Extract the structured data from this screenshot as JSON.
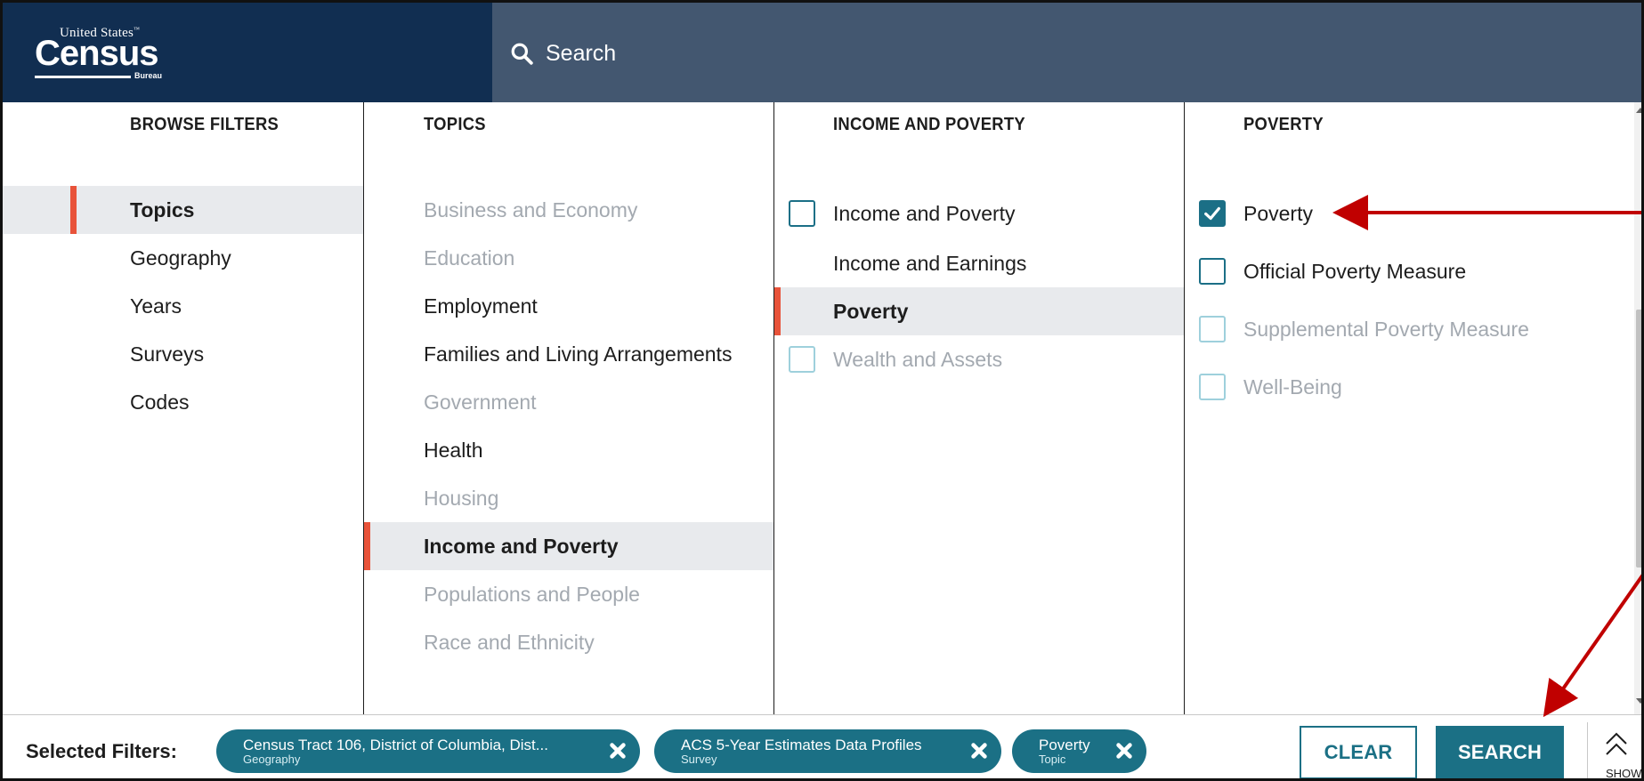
{
  "header": {
    "logo": {
      "top": "United States",
      "main": "Census",
      "bottom": "Bureau"
    },
    "search_placeholder": "Search"
  },
  "columns": {
    "browse": {
      "title": "BROWSE FILTERS",
      "items": [
        "Topics",
        "Geography",
        "Years",
        "Surveys",
        "Codes"
      ],
      "active": "Topics"
    },
    "topics": {
      "title": "TOPICS",
      "items": [
        {
          "label": "Business and Economy",
          "state": "dim"
        },
        {
          "label": "Education",
          "state": "dim"
        },
        {
          "label": "Employment",
          "state": "normal"
        },
        {
          "label": "Families and Living Arrangements",
          "state": "normal"
        },
        {
          "label": "Government",
          "state": "dim"
        },
        {
          "label": "Health",
          "state": "normal"
        },
        {
          "label": "Housing",
          "state": "dim"
        },
        {
          "label": "Income and Poverty",
          "state": "active"
        },
        {
          "label": "Populations and People",
          "state": "dim"
        },
        {
          "label": "Race and Ethnicity",
          "state": "dim"
        }
      ]
    },
    "income_poverty": {
      "title": "INCOME AND POVERTY",
      "items": [
        {
          "label": "Income and Poverty",
          "checkbox": "unchecked"
        },
        {
          "label": "Income and Earnings",
          "checkbox": "none"
        },
        {
          "label": "Poverty",
          "checkbox": "none",
          "active": true
        },
        {
          "label": "Wealth and Assets",
          "checkbox": "disabled"
        }
      ]
    },
    "poverty": {
      "title": "POVERTY",
      "items": [
        {
          "label": "Poverty",
          "checkbox": "checked"
        },
        {
          "label": "Official Poverty Measure",
          "checkbox": "unchecked"
        },
        {
          "label": "Supplemental Poverty Measure",
          "checkbox": "disabled"
        },
        {
          "label": "Well-Being",
          "checkbox": "disabled"
        }
      ]
    }
  },
  "footer": {
    "selected_label": "Selected Filters:",
    "chips": [
      {
        "title": "Census Tract 106, District of Columbia, Dist...",
        "type": "Geography"
      },
      {
        "title": "ACS 5-Year Estimates Data Profiles",
        "type": "Survey"
      },
      {
        "title": "Poverty",
        "type": "Topic"
      }
    ],
    "clear_label": "CLEAR",
    "search_label": "SEARCH",
    "show_label": "SHOW"
  },
  "colors": {
    "header_dark": "#112e51",
    "header_light": "#435770",
    "accent_teal": "#1b7085",
    "active_marker": "#e8533a",
    "annotation_arrow": "#c00000"
  }
}
